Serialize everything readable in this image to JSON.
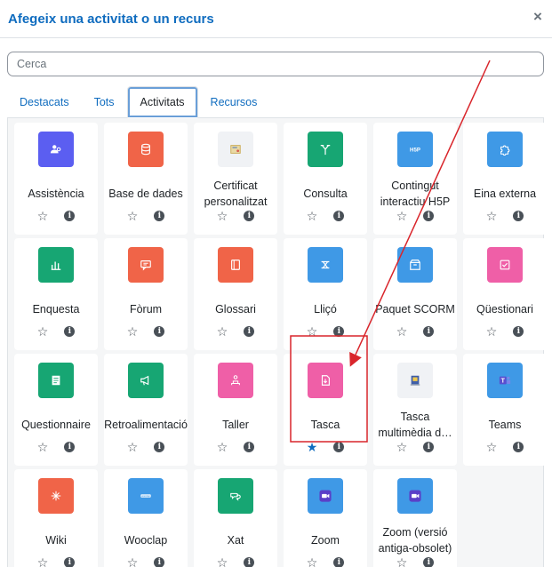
{
  "dialog": {
    "title": "Afegeix una activitat o un recurs",
    "close_label": "×"
  },
  "search": {
    "placeholder": "Cerca"
  },
  "tabs": [
    {
      "label": "Destacats",
      "active": false
    },
    {
      "label": "Tots",
      "active": false
    },
    {
      "label": "Activitats",
      "active": true
    },
    {
      "label": "Recursos",
      "active": false
    }
  ],
  "activities": [
    {
      "name": "Assistència",
      "icon": "attendance-icon",
      "color": "#5b5ef1",
      "starred": false
    },
    {
      "name": "Base de dades",
      "icon": "database-icon",
      "color": "#f06448",
      "starred": false
    },
    {
      "name": "Certificat personalitzat",
      "icon": "certificate-icon",
      "color": "#f0f2f5",
      "starred": false
    },
    {
      "name": "Consulta",
      "icon": "choice-icon",
      "color": "#17a673",
      "starred": false
    },
    {
      "name": "Contingut interactiu H5P",
      "icon": "h5p-icon",
      "color": "#3f99e6",
      "starred": false
    },
    {
      "name": "Eina externa",
      "icon": "puzzle-icon",
      "color": "#3f99e6",
      "starred": false
    },
    {
      "name": "Enquesta",
      "icon": "survey-chart-icon",
      "color": "#17a673",
      "starred": false
    },
    {
      "name": "Fòrum",
      "icon": "forum-icon",
      "color": "#f06448",
      "starred": false
    },
    {
      "name": "Glossari",
      "icon": "glossary-book-icon",
      "color": "#f06448",
      "starred": false
    },
    {
      "name": "Lliçó",
      "icon": "lesson-icon",
      "color": "#3f99e6",
      "starred": false
    },
    {
      "name": "Paquet SCORM",
      "icon": "scorm-package-icon",
      "color": "#3f99e6",
      "starred": false
    },
    {
      "name": "Qüestionari",
      "icon": "quiz-icon",
      "color": "#ef5fa7",
      "starred": false
    },
    {
      "name": "Questionnaire",
      "icon": "questionnaire-icon",
      "color": "#17a673",
      "starred": false
    },
    {
      "name": "Retroalimentació",
      "icon": "feedback-megaphone-icon",
      "color": "#17a673",
      "starred": false
    },
    {
      "name": "Taller",
      "icon": "workshop-icon",
      "color": "#ef5fa7",
      "starred": false
    },
    {
      "name": "Tasca",
      "icon": "assignment-icon",
      "color": "#ef5fa7",
      "starred": true
    },
    {
      "name": "Tasca multimèdia d…",
      "icon": "multimedia-assignment-icon",
      "color": "#f0f2f5",
      "starred": false
    },
    {
      "name": "Teams",
      "icon": "teams-icon",
      "color": "#3f99e6",
      "starred": false
    },
    {
      "name": "Wiki",
      "icon": "wiki-icon",
      "color": "#f06448",
      "starred": false
    },
    {
      "name": "Wooclap",
      "icon": "wooclap-icon",
      "color": "#3f99e6",
      "starred": false
    },
    {
      "name": "Xat",
      "icon": "chat-icon",
      "color": "#17a673",
      "starred": false
    },
    {
      "name": "Zoom",
      "icon": "zoom-icon",
      "color": "#3f99e6",
      "starred": false
    },
    {
      "name": "Zoom (versió antiga-obsolet)",
      "icon": "zoom-icon",
      "color": "#3f99e6",
      "starred": false
    }
  ],
  "action_glyphs": {
    "star_empty": "☆",
    "star_filled": "★",
    "info": "i"
  },
  "annotation": {
    "highlight_color": "#d9252b"
  }
}
